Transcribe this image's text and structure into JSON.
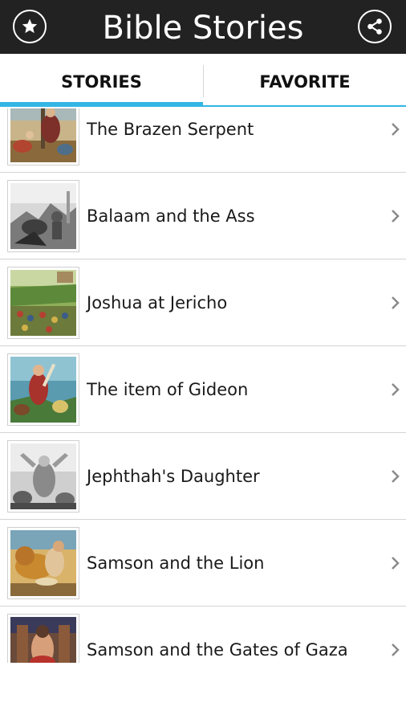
{
  "header": {
    "title": "Bible Stories",
    "left_icon": "star-icon",
    "right_icon": "share-icon"
  },
  "tabs": [
    {
      "label": "STORIES",
      "active": true
    },
    {
      "label": "FAVORITE",
      "active": false
    }
  ],
  "colors": {
    "header_bg": "#222222",
    "accent": "#33b5e5",
    "divider": "#d4d4d4"
  },
  "stories": [
    {
      "title": "The Brazen Serpent",
      "thumbnail": "illustration-desert-scene"
    },
    {
      "title": "Balaam and the Ass",
      "thumbnail": "illustration-engraving-bw"
    },
    {
      "title": "Joshua at Jericho",
      "thumbnail": "illustration-army-landscape"
    },
    {
      "title": "The item of Gideon",
      "thumbnail": "illustration-warrior-sky"
    },
    {
      "title": "Jephthah's Daughter",
      "thumbnail": "illustration-engraving-bw"
    },
    {
      "title": "Samson and the Lion",
      "thumbnail": "illustration-lion-struggle"
    },
    {
      "title": "Samson and the Gates of Gaza",
      "thumbnail": "illustration-samson-gates"
    }
  ]
}
